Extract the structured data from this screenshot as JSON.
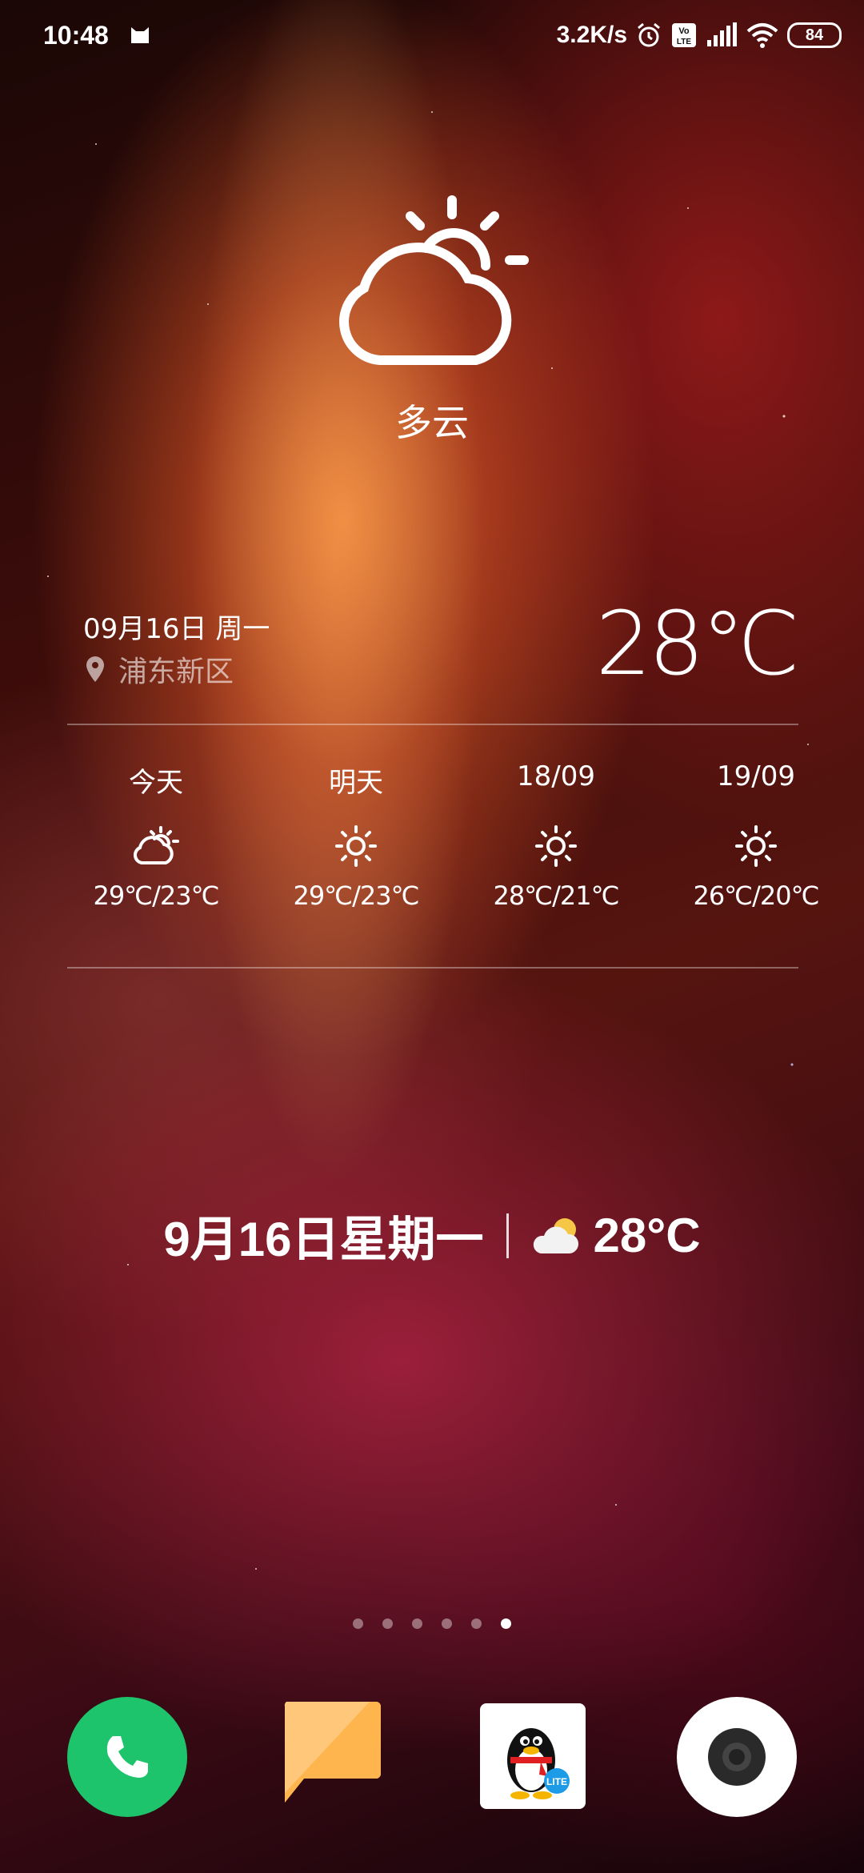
{
  "status_bar": {
    "time": "10:48",
    "network_speed": "3.2K/s",
    "volte_badge": "VoLTE",
    "battery": "84",
    "icons": [
      "cat-notification-icon",
      "alarm-icon",
      "volte-icon",
      "signal-icon",
      "wifi-icon",
      "battery-icon"
    ]
  },
  "weather": {
    "condition": "多云",
    "date": "09月16日 周一",
    "location": "浦东新区",
    "current_temp": "28℃",
    "forecast": [
      {
        "label": "今天",
        "icon": "partly-cloudy-icon",
        "temp": "29℃/23℃"
      },
      {
        "label": "明天",
        "icon": "sunny-icon",
        "temp": "29℃/23℃"
      },
      {
        "label": "18/09",
        "icon": "sunny-icon",
        "temp": "28℃/21℃"
      },
      {
        "label": "19/09",
        "icon": "sunny-icon",
        "temp": "26℃/20℃"
      }
    ]
  },
  "date_widget": {
    "date": "9月16日星期一",
    "temp": "28°C",
    "icon": "cloud-sun-icon"
  },
  "pager": {
    "page_count": 6,
    "active_page": 6
  },
  "dock": {
    "apps": [
      {
        "name": "phone",
        "icon": "phone-icon",
        "color": "#1ec46c"
      },
      {
        "name": "messages",
        "icon": "message-icon",
        "color": "#ffc77a"
      },
      {
        "name": "qq-lite",
        "icon": "qq-penguin-icon",
        "badge": "LITE"
      },
      {
        "name": "camera",
        "icon": "camera-icon",
        "color": "#ffffff"
      }
    ]
  }
}
